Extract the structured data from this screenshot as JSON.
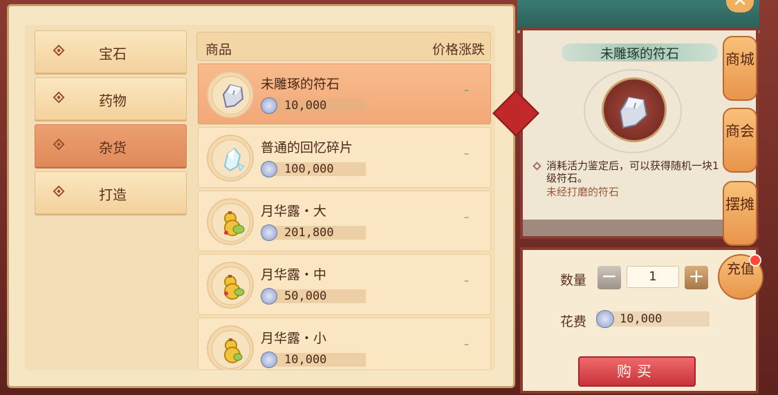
{
  "categories": [
    {
      "label": "宝石"
    },
    {
      "label": "药物"
    },
    {
      "label": "杂货",
      "active": true
    },
    {
      "label": "打造"
    }
  ],
  "table": {
    "col_item": "商品",
    "col_change": "价格涨跌",
    "rows": [
      {
        "name": "未雕琢的符石",
        "price": "10,000",
        "change": "–",
        "icon": "rune-stone-icon"
      },
      {
        "name": "普通的回忆碎片",
        "price": "100,000",
        "change": "–",
        "icon": "crystal-shard-icon"
      },
      {
        "name": "月华露・大",
        "price": "201,800",
        "change": "–",
        "icon": "gourd-potion-icon"
      },
      {
        "name": "月华露・中",
        "price": "50,000",
        "change": "–",
        "icon": "gourd-potion-icon"
      },
      {
        "name": "月华露・小",
        "price": "10,000",
        "change": "–",
        "icon": "gourd-potion-icon"
      }
    ]
  },
  "detail": {
    "title": "未雕琢的符石",
    "description": "消耗活力鉴定后，可以获得随机一块1级符石。",
    "subdescription": "未经打磨的符石",
    "qty_label": "数量",
    "qty_value": "1",
    "cost_label": "花费",
    "cost_value": "10,000",
    "buy_label": "购买"
  },
  "side_tabs": [
    {
      "label": "商城"
    },
    {
      "label": "商会"
    },
    {
      "label": "摆摊"
    }
  ],
  "recharge_label": "充值",
  "colors": {
    "accent": "#e08a5a",
    "buy": "#c8333b",
    "positive": "#3a9a3a"
  }
}
